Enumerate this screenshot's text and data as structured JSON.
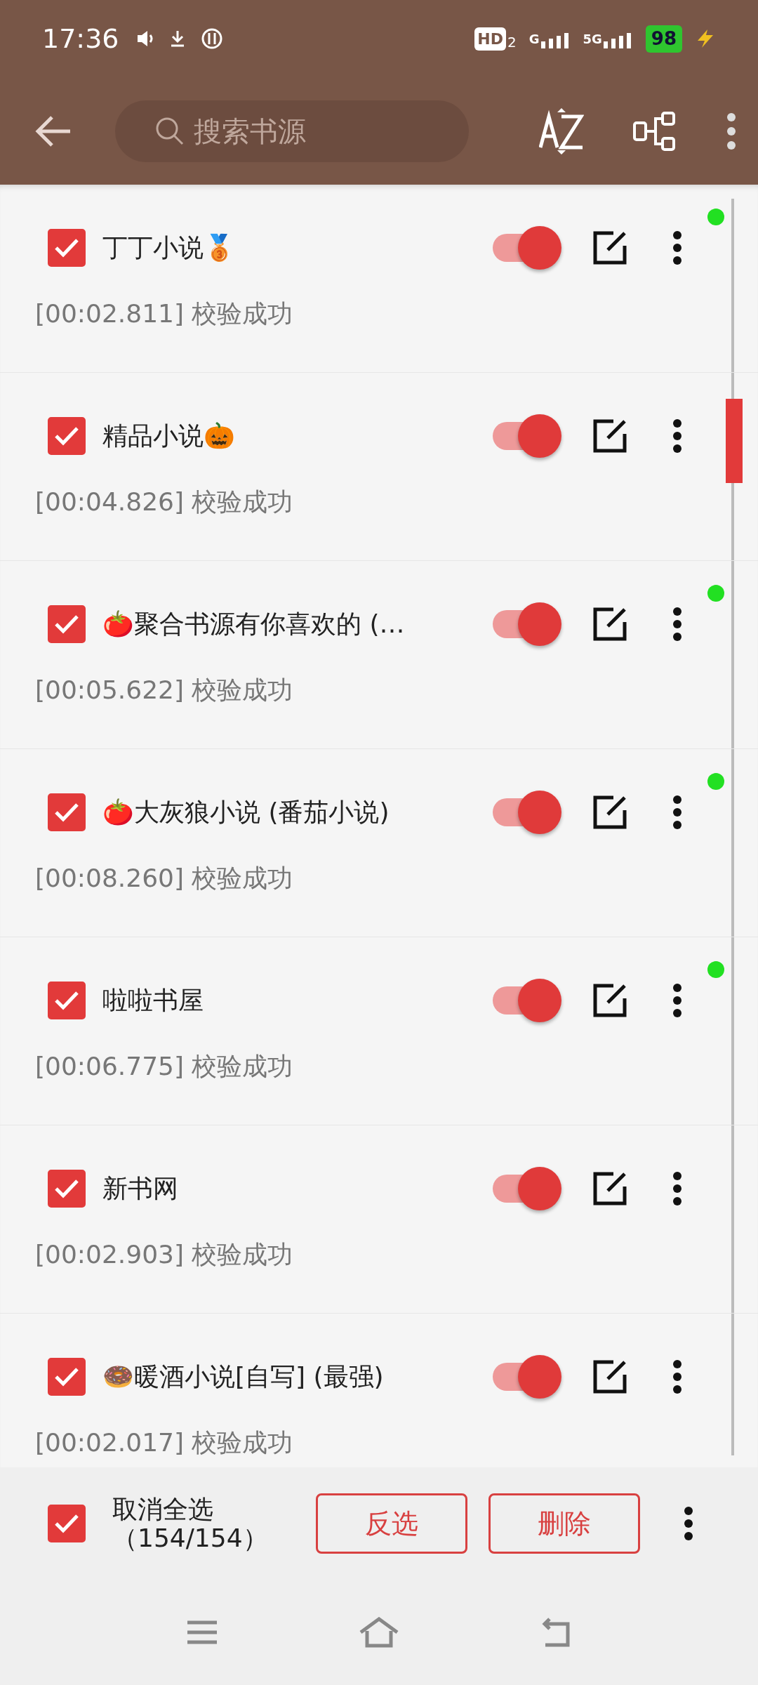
{
  "status_bar": {
    "time": "17:36",
    "hd": "HD",
    "hd_sub": "2",
    "net1": "G",
    "net2": "5G",
    "battery": "98"
  },
  "toolbar": {
    "search": {
      "placeholder": "搜索书源"
    }
  },
  "sources": [
    {
      "name": "丁丁小说🥉",
      "result": "[00:02.811] 校验成功",
      "checked": true,
      "enabled": true,
      "status_dot": true
    },
    {
      "name": "精品小说🎃",
      "result": "[00:04.826] 校验成功",
      "checked": true,
      "enabled": true,
      "status_dot": false
    },
    {
      "name": "🍅聚合书源有你喜欢的 (…",
      "result": "[00:05.622] 校验成功",
      "checked": true,
      "enabled": true,
      "status_dot": true
    },
    {
      "name": "🍅大灰狼小说 (番茄小说)",
      "result": "[00:08.260] 校验成功",
      "checked": true,
      "enabled": true,
      "status_dot": true
    },
    {
      "name": "啦啦书屋",
      "result": "[00:06.775] 校验成功",
      "checked": true,
      "enabled": true,
      "status_dot": true
    },
    {
      "name": "新书网",
      "result": "[00:02.903] 校验成功",
      "checked": true,
      "enabled": true,
      "status_dot": false
    },
    {
      "name": "🍩暖酒小说[自写] (最强)",
      "result": "[00:02.017] 校验成功",
      "checked": true,
      "enabled": true,
      "status_dot": false
    }
  ],
  "bottom_bar": {
    "select_all": {
      "checked": true,
      "label": "取消全选",
      "count": "（154/154）"
    },
    "buttons": [
      "反选",
      "删除"
    ]
  }
}
